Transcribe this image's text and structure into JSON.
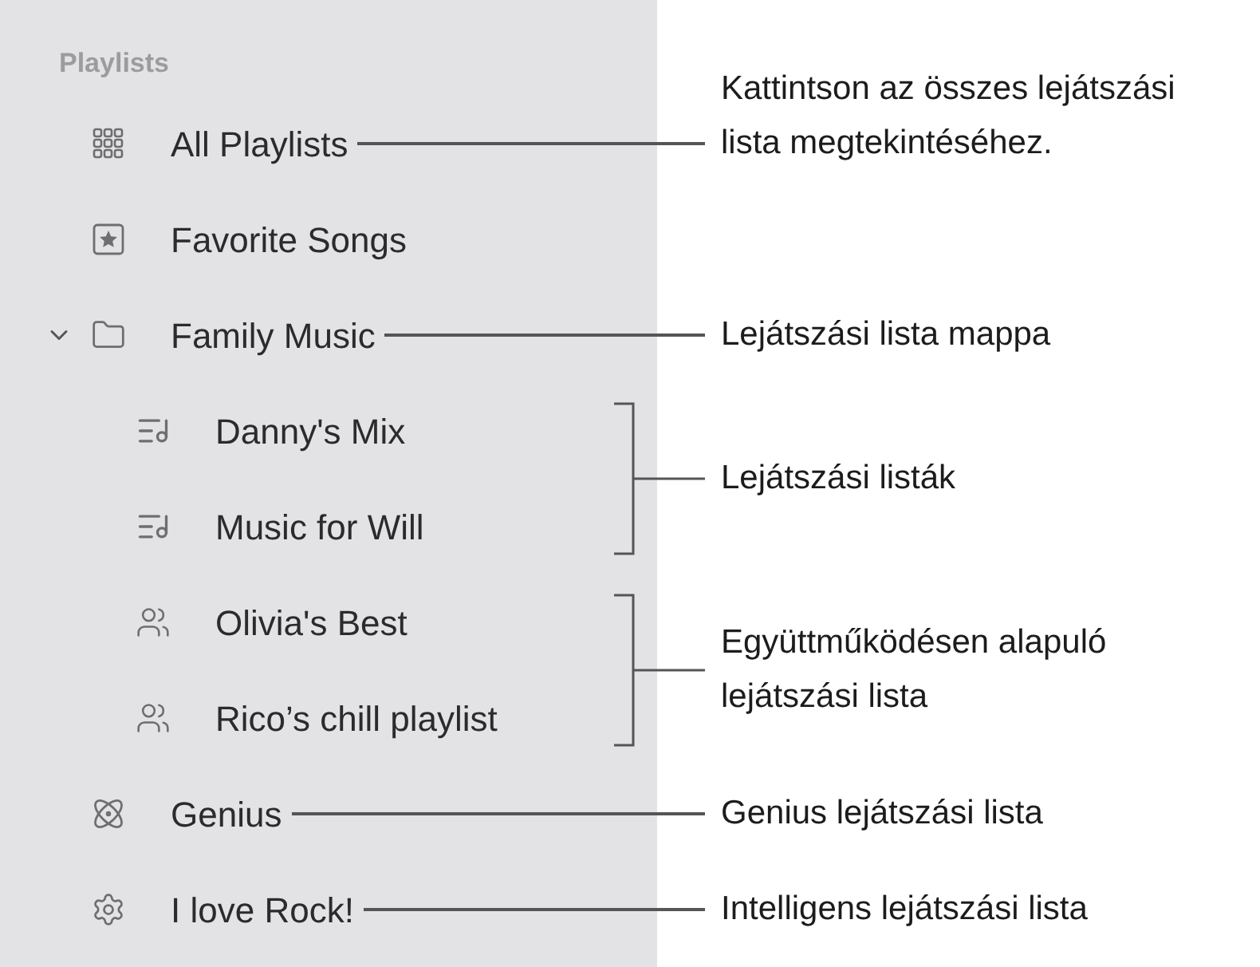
{
  "sidebar": {
    "header": "Playlists",
    "items": [
      {
        "label": "All Playlists",
        "kind": "all",
        "callout": "Kattintson az összes lejátszási lista megtekintéséhez."
      },
      {
        "label": "Favorite Songs",
        "kind": "favorites"
      },
      {
        "label": "Family Music",
        "kind": "folder",
        "expanded": true,
        "callout": "Lejátszási lista mappa",
        "children": [
          {
            "kind": "group",
            "callout": "Lejátszási listák",
            "children": [
              {
                "label": "Danny's Mix",
                "kind": "playlist"
              },
              {
                "label": "Music for Will",
                "kind": "playlist"
              }
            ]
          },
          {
            "kind": "group",
            "callout": "Együttműködésen alapuló lejátszási lista",
            "children": [
              {
                "label": "Olivia's Best",
                "kind": "shared"
              },
              {
                "label": "Rico’s chill playlist",
                "kind": "shared"
              }
            ]
          }
        ]
      },
      {
        "label": "Genius",
        "kind": "genius",
        "callout": "Genius lejátszási lista"
      },
      {
        "label": "I love Rock!",
        "kind": "smart",
        "callout": "Intelligens lejátszási lista"
      }
    ]
  }
}
